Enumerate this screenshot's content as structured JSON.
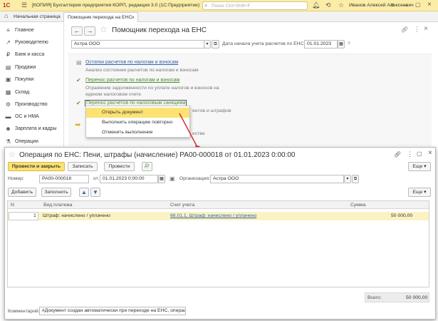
{
  "app": {
    "logo": "1С",
    "title": "[КОПИЯ] Бухгалтерия предприятия КОРП, редакция 3.0  (1С:Предприятие)",
    "search_placeholder": "Поиск Ctrl+Shift+F",
    "user": "Иванов Алексей Алексеевич"
  },
  "tabs": [
    {
      "label": "Начальная страница"
    },
    {
      "label": "Помощник перехода на ЕНС"
    }
  ],
  "sidebar": {
    "items": [
      {
        "label": "Главное",
        "icon": "≡"
      },
      {
        "label": "Руководителю",
        "icon": "↗"
      },
      {
        "label": "Банк и касса",
        "icon": "₽"
      },
      {
        "label": "Продажи",
        "icon": "▤"
      },
      {
        "label": "Покупки",
        "icon": "▣"
      },
      {
        "label": "Склад",
        "icon": "▦"
      },
      {
        "label": "Производство",
        "icon": "⚙"
      },
      {
        "label": "ОС и НМА",
        "icon": "▬"
      },
      {
        "label": "Зарплата и кадры",
        "icon": "☻"
      },
      {
        "label": "Операции",
        "icon": "⚗"
      }
    ]
  },
  "assistant": {
    "title": "Помощник перехода на ЕНС",
    "org": "Астра ООО",
    "date_label": "Дата начала учета расчетов по ЕНС:",
    "date": "01.01.2023",
    "help": "?",
    "steps": [
      {
        "link": "Остатки расчетов по налогам и взносам",
        "desc": "Анализ состояния расчетов по налогам и взносам"
      },
      {
        "link": "Перенос расчетов по налогам и взносам",
        "desc1": "Отражение задолженности по уплате налогов и взносов на",
        "desc2": "едином налоговом счете"
      },
      {
        "link": "Перенос расчетов по налоговым санкциям",
        "desc_tail": "ентов и штрафов",
        "desc_tail2": "естве"
      }
    ]
  },
  "context_menu": {
    "items": [
      {
        "label": "Открыть документ"
      },
      {
        "label": "Выполнить операцию повторно"
      },
      {
        "label": "Отменить выполнение"
      }
    ]
  },
  "dialog": {
    "title": "Операция по ЕНС: Пени, штрафы (начисление) РА00-000018 от 01.01.2023 0:00:00",
    "post_close": "Провести и закрыть",
    "save": "Записать",
    "post": "Провести",
    "more": "Еще ▾",
    "number_label": "Номер:",
    "number": "РА00-000018",
    "date_label": "от:",
    "date": "01.01.2023  0:00:00",
    "org_label": "Организация:",
    "org": "Астра ООО",
    "add": "Добавить",
    "fill": "Заполнить",
    "more2": "Еще ▾",
    "columns": [
      "N",
      "Вид платежа",
      "Счет учета",
      "Сумма"
    ],
    "rows": [
      {
        "n": "1",
        "kind": "Штраф: начислено / уплачено",
        "account": "68.01.1, Штраф: начислено / уплачено",
        "sum": "50 000,00"
      }
    ],
    "total_label": "Всего:",
    "total": "50 000,00",
    "comment_label": "Комментарий:",
    "comment": "#Документ создан автоматически при переходе на ЕНС, операция"
  }
}
